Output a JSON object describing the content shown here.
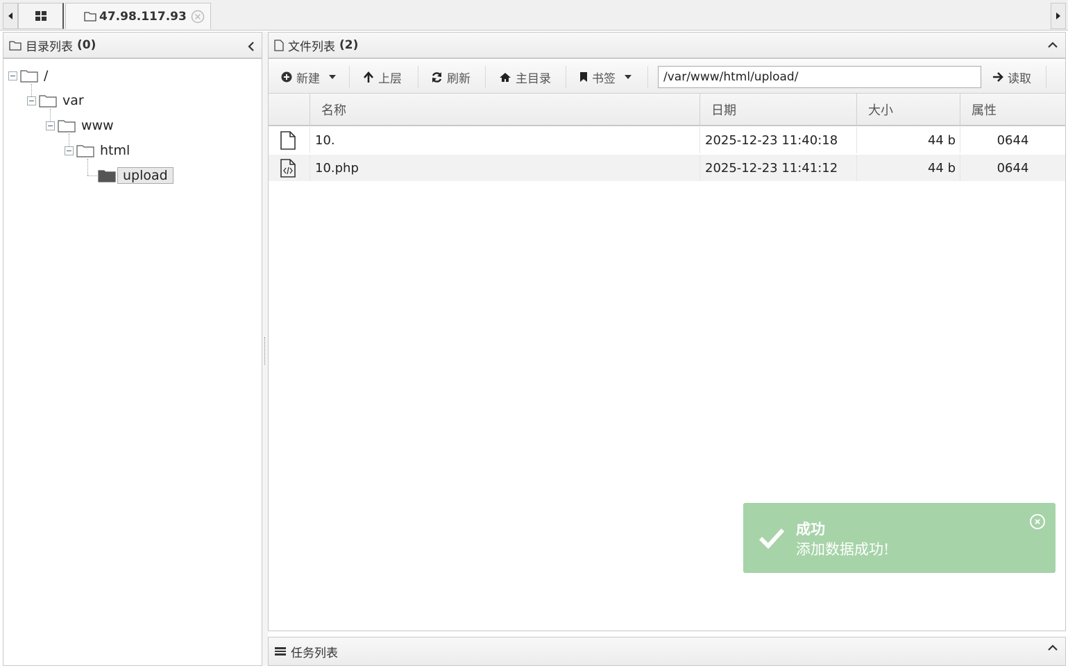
{
  "tabs": {
    "host_label": "47.98.117.93"
  },
  "left_panel": {
    "title": "目录列表",
    "count": "(0)",
    "tree": [
      "/",
      "var",
      "www",
      "html",
      "upload"
    ]
  },
  "right_panel": {
    "title": "文件列表",
    "count": "(2)"
  },
  "toolbar": {
    "new_label": "新建",
    "up_label": "上层",
    "refresh_label": "刷新",
    "home_label": "主目录",
    "bookmark_label": "书签",
    "path_value": "/var/www/html/upload/",
    "read_label": "读取"
  },
  "grid": {
    "headers": [
      "名称",
      "日期",
      "大小",
      "属性"
    ],
    "rows": [
      {
        "icon": "file-icon",
        "name": "10.",
        "date": "2025-12-23 11:40:18",
        "size": "44 b",
        "perm": "0644"
      },
      {
        "icon": "code-file-icon",
        "name": "10.php",
        "date": "2025-12-23 11:41:12",
        "size": "44 b",
        "perm": "0644"
      }
    ]
  },
  "task_panel": {
    "title": "任务列表"
  },
  "toast": {
    "title": "成功",
    "message": "添加数据成功!",
    "color": "#a6d3a8"
  }
}
